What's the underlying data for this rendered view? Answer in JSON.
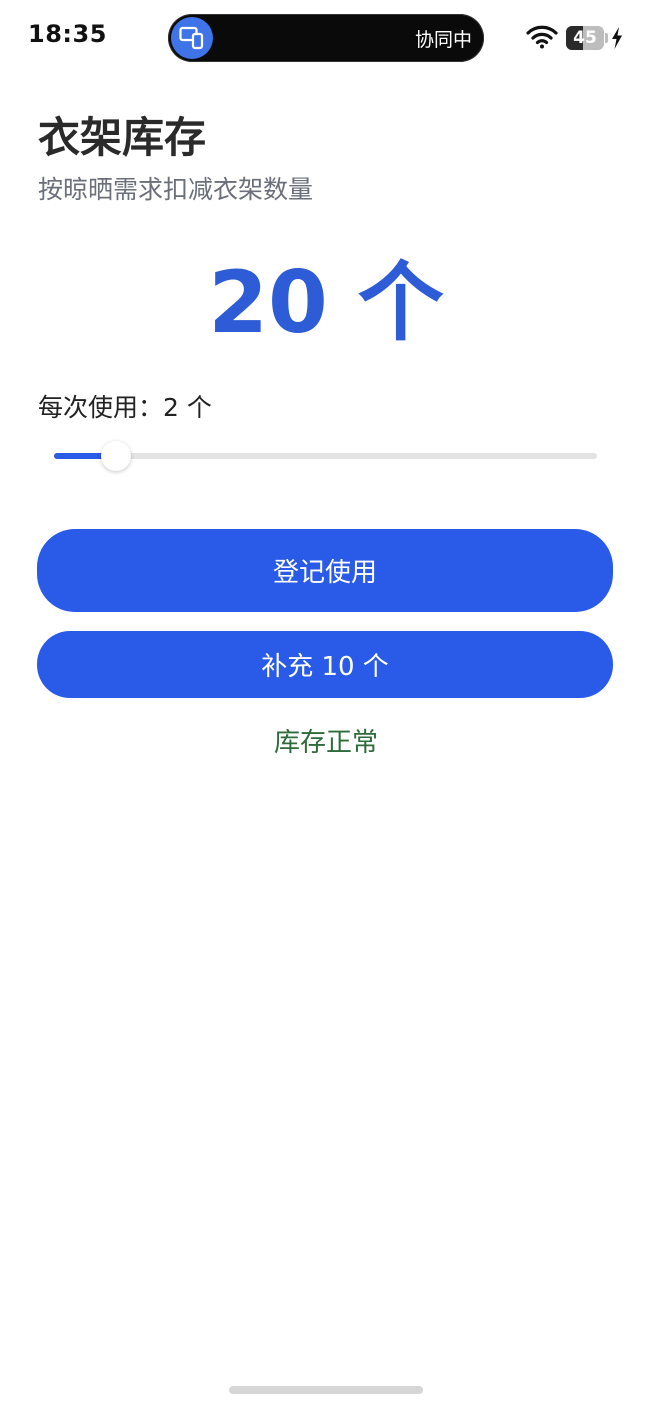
{
  "status_bar": {
    "time": "18:35",
    "collab_text": "协同中",
    "battery_level": "45",
    "battery_fraction": 0.45,
    "icons": [
      "devices-icon",
      "wifi-icon",
      "battery-icon",
      "charging-icon"
    ]
  },
  "header": {
    "title": "衣架库存",
    "subtitle": "按晾晒需求扣减衣架数量"
  },
  "stock": {
    "count_display": "20 个",
    "count": 20
  },
  "usage": {
    "label": "每次使用：2 个",
    "value": 2,
    "slider_fraction": 0.115
  },
  "actions": {
    "use_label": "登记使用",
    "refill_label": "补充 10 个"
  },
  "status": {
    "text": "库存正常"
  },
  "colors": {
    "accent": "#2a5be8",
    "count_text": "#2e5bd6",
    "status_ok": "#2e6b3a",
    "subtitle": "#6a6f7a"
  }
}
